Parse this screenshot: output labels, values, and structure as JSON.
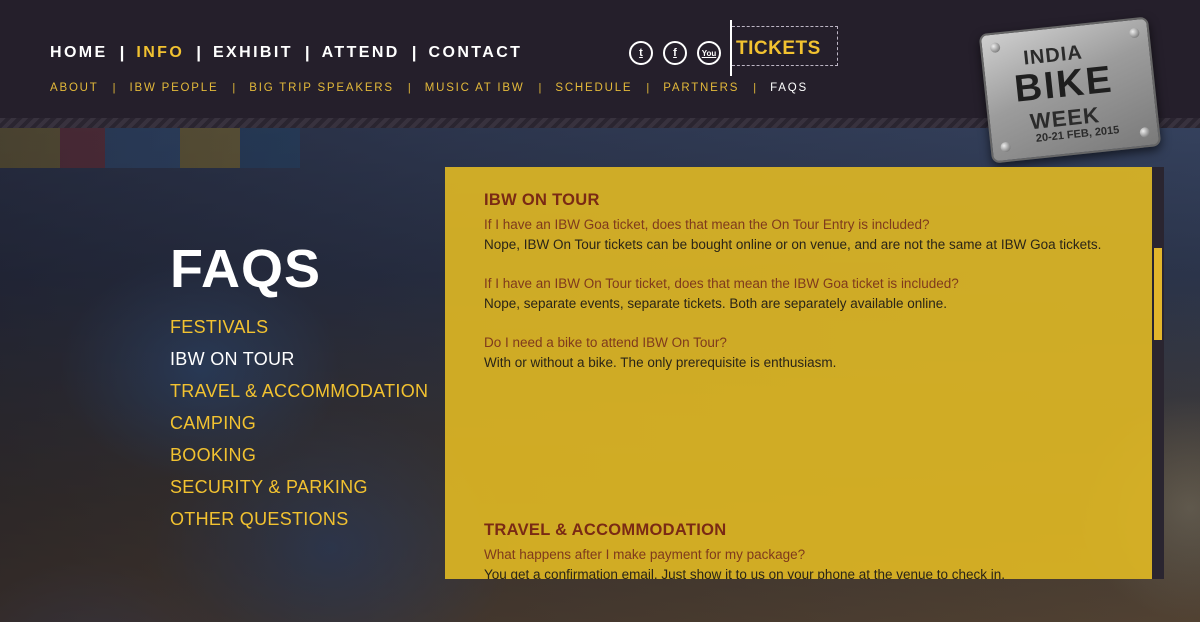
{
  "main_nav": [
    {
      "label": "HOME",
      "active": false
    },
    {
      "label": "INFO",
      "active": true
    },
    {
      "label": "EXHIBIT",
      "active": false
    },
    {
      "label": "ATTEND",
      "active": false
    },
    {
      "label": "CONTACT",
      "active": false
    }
  ],
  "sub_nav": [
    {
      "label": "ABOUT",
      "active": false
    },
    {
      "label": "IBW PEOPLE",
      "active": false
    },
    {
      "label": "BIG TRIP SPEAKERS",
      "active": false
    },
    {
      "label": "MUSIC AT IBW",
      "active": false
    },
    {
      "label": "SCHEDULE",
      "active": false
    },
    {
      "label": "PARTNERS",
      "active": false
    },
    {
      "label": "FAQS",
      "active": true
    }
  ],
  "separator": "|",
  "social": [
    {
      "icon": "twitter-icon",
      "glyph": "t"
    },
    {
      "icon": "facebook-icon",
      "glyph": "f"
    },
    {
      "icon": "youtube-icon",
      "glyph": "You"
    }
  ],
  "tickets_label": "TICKETS",
  "logo": {
    "line1": "INDIA",
    "line2": "BIKE",
    "line3": "WEEK",
    "line4": "20-21 FEB, 2015"
  },
  "faq": {
    "title": "FAQS",
    "categories": [
      {
        "label": "FESTIVALS",
        "active": false
      },
      {
        "label": "IBW ON TOUR",
        "active": true
      },
      {
        "label": "TRAVEL & ACCOMMODATION",
        "active": false
      },
      {
        "label": "CAMPING",
        "active": false
      },
      {
        "label": "BOOKING",
        "active": false
      },
      {
        "label": "SECURITY & PARKING",
        "active": false
      },
      {
        "label": "OTHER QUESTIONS",
        "active": false
      }
    ]
  },
  "sections": [
    {
      "title": "IBW ON TOUR",
      "items": [
        {
          "q": "If I have an IBW Goa ticket, does that mean the On Tour Entry is included?",
          "a": "Nope, IBW On Tour tickets can be bought online or on venue, and are not the same at IBW Goa tickets."
        },
        {
          "q": "If I have an IBW On Tour ticket, does that mean the IBW Goa ticket is included?",
          "a": "Nope, separate events, separate tickets. Both are separately available online."
        },
        {
          "q": "Do I need a bike to attend IBW On Tour?",
          "a": "With or without a bike. The only prerequisite is enthusiasm."
        }
      ]
    },
    {
      "title": "TRAVEL & ACCOMMODATION",
      "items": [
        {
          "q": "What happens after I make payment for my package?",
          "a": "You get a confirmation email. Just show it to us on your phone at the venue to check in."
        }
      ]
    }
  ],
  "colors": {
    "accent": "#f2c230",
    "header_bg": "#251f2b",
    "panel_bg": "#e1b923",
    "question_text": "#7f3a1c",
    "section_title": "#7a2a14"
  }
}
